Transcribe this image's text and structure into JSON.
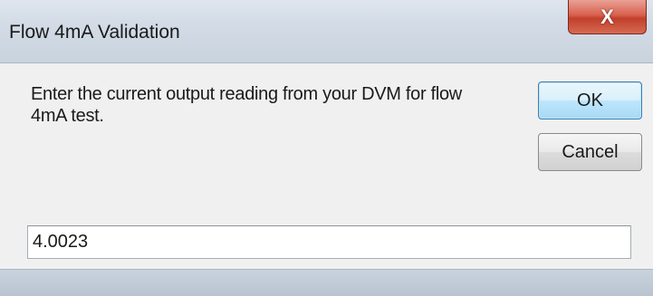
{
  "window": {
    "title": "Flow 4mA Validation",
    "close_label": "X"
  },
  "dialog": {
    "prompt": "Enter the current output reading from your DVM for flow 4mA test.",
    "ok_label": "OK",
    "cancel_label": "Cancel",
    "input_value": "4.0023"
  },
  "colors": {
    "close_button": "#d9604d",
    "default_button_border": "#3c7fb1",
    "window_frame": "#d2dbe6"
  }
}
